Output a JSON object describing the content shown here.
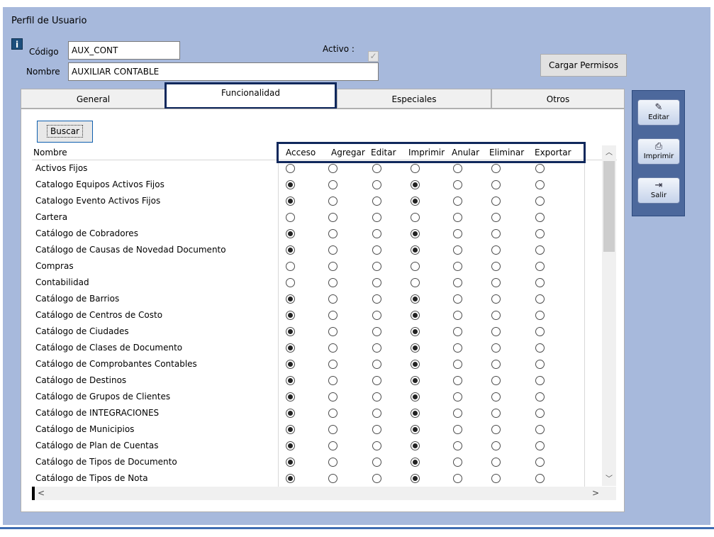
{
  "window": {
    "title": "Perfil de Usuario"
  },
  "form": {
    "codigo_label": "Código",
    "codigo_value": "AUX_CONT",
    "nombre_label": "Nombre",
    "nombre_value": "AUXILIAR CONTABLE",
    "activo_label": "Activo :",
    "activo_checked": true,
    "cargar_label": "Cargar Permisos",
    "info_glyph": "i"
  },
  "tabs": [
    {
      "label": "General",
      "active": false
    },
    {
      "label": "Funcionalidad",
      "active": true
    },
    {
      "label": "Especiales",
      "active": false
    },
    {
      "label": "Otros",
      "active": false
    }
  ],
  "buscar_label": "Buscar",
  "table": {
    "columns": [
      "Nombre",
      "Acceso",
      "Agregar",
      "Editar",
      "Imprimir",
      "Anular",
      "Eliminar",
      "Exportar"
    ],
    "rows": [
      {
        "name": "Activos Fijos",
        "values": [
          0,
          0,
          0,
          0,
          0,
          0,
          0
        ]
      },
      {
        "name": "Catalogo Equipos Activos Fijos",
        "values": [
          1,
          0,
          0,
          1,
          0,
          0,
          0
        ]
      },
      {
        "name": "Catalogo Evento Activos Fijos",
        "values": [
          1,
          0,
          0,
          1,
          0,
          0,
          0
        ]
      },
      {
        "name": "Cartera",
        "values": [
          0,
          0,
          0,
          0,
          0,
          0,
          0
        ]
      },
      {
        "name": "Catálogo de Cobradores",
        "values": [
          1,
          0,
          0,
          1,
          0,
          0,
          0
        ]
      },
      {
        "name": "Catálogo de Causas de Novedad Documento",
        "values": [
          1,
          0,
          0,
          1,
          0,
          0,
          0
        ]
      },
      {
        "name": "Compras",
        "values": [
          0,
          0,
          0,
          0,
          0,
          0,
          0
        ]
      },
      {
        "name": "Contabilidad",
        "values": [
          0,
          0,
          0,
          0,
          0,
          0,
          0
        ]
      },
      {
        "name": "Catálogo de Barrios",
        "values": [
          1,
          0,
          0,
          1,
          0,
          0,
          0
        ]
      },
      {
        "name": "Catálogo de Centros de Costo",
        "values": [
          1,
          0,
          0,
          1,
          0,
          0,
          0
        ]
      },
      {
        "name": "Catálogo de Ciudades",
        "values": [
          1,
          0,
          0,
          1,
          0,
          0,
          0
        ]
      },
      {
        "name": "Catálogo de Clases de Documento",
        "values": [
          1,
          0,
          0,
          1,
          0,
          0,
          0
        ]
      },
      {
        "name": "Catálogo de Comprobantes Contables",
        "values": [
          1,
          0,
          0,
          1,
          0,
          0,
          0
        ]
      },
      {
        "name": "Catálogo de Destinos",
        "values": [
          1,
          0,
          0,
          1,
          0,
          0,
          0
        ]
      },
      {
        "name": "Catálogo de Grupos de Clientes",
        "values": [
          1,
          0,
          0,
          1,
          0,
          0,
          0
        ]
      },
      {
        "name": "Catálogo de INTEGRACIONES",
        "values": [
          1,
          0,
          0,
          1,
          0,
          0,
          0
        ]
      },
      {
        "name": "Catálogo de Municipios",
        "values": [
          1,
          0,
          0,
          1,
          0,
          0,
          0
        ]
      },
      {
        "name": "Catálogo de Plan de Cuentas",
        "values": [
          1,
          0,
          0,
          1,
          0,
          0,
          0
        ]
      },
      {
        "name": "Catálogo de Tipos de Documento",
        "values": [
          1,
          0,
          0,
          1,
          0,
          0,
          0
        ]
      },
      {
        "name": "Catálogo de Tipos de Nota",
        "values": [
          1,
          0,
          0,
          1,
          0,
          0,
          0
        ]
      }
    ]
  },
  "side_buttons": [
    {
      "label": "Editar",
      "icon": "edit-icon",
      "glyph": "✎"
    },
    {
      "label": "Imprimir",
      "icon": "printer-icon",
      "glyph": "⎙"
    },
    {
      "label": "Salir",
      "icon": "exit-icon",
      "glyph": "⇥"
    }
  ],
  "colors": {
    "accent": "#10285c",
    "window_bg": "#a7b9dc",
    "side_panel": "#4c689c"
  }
}
